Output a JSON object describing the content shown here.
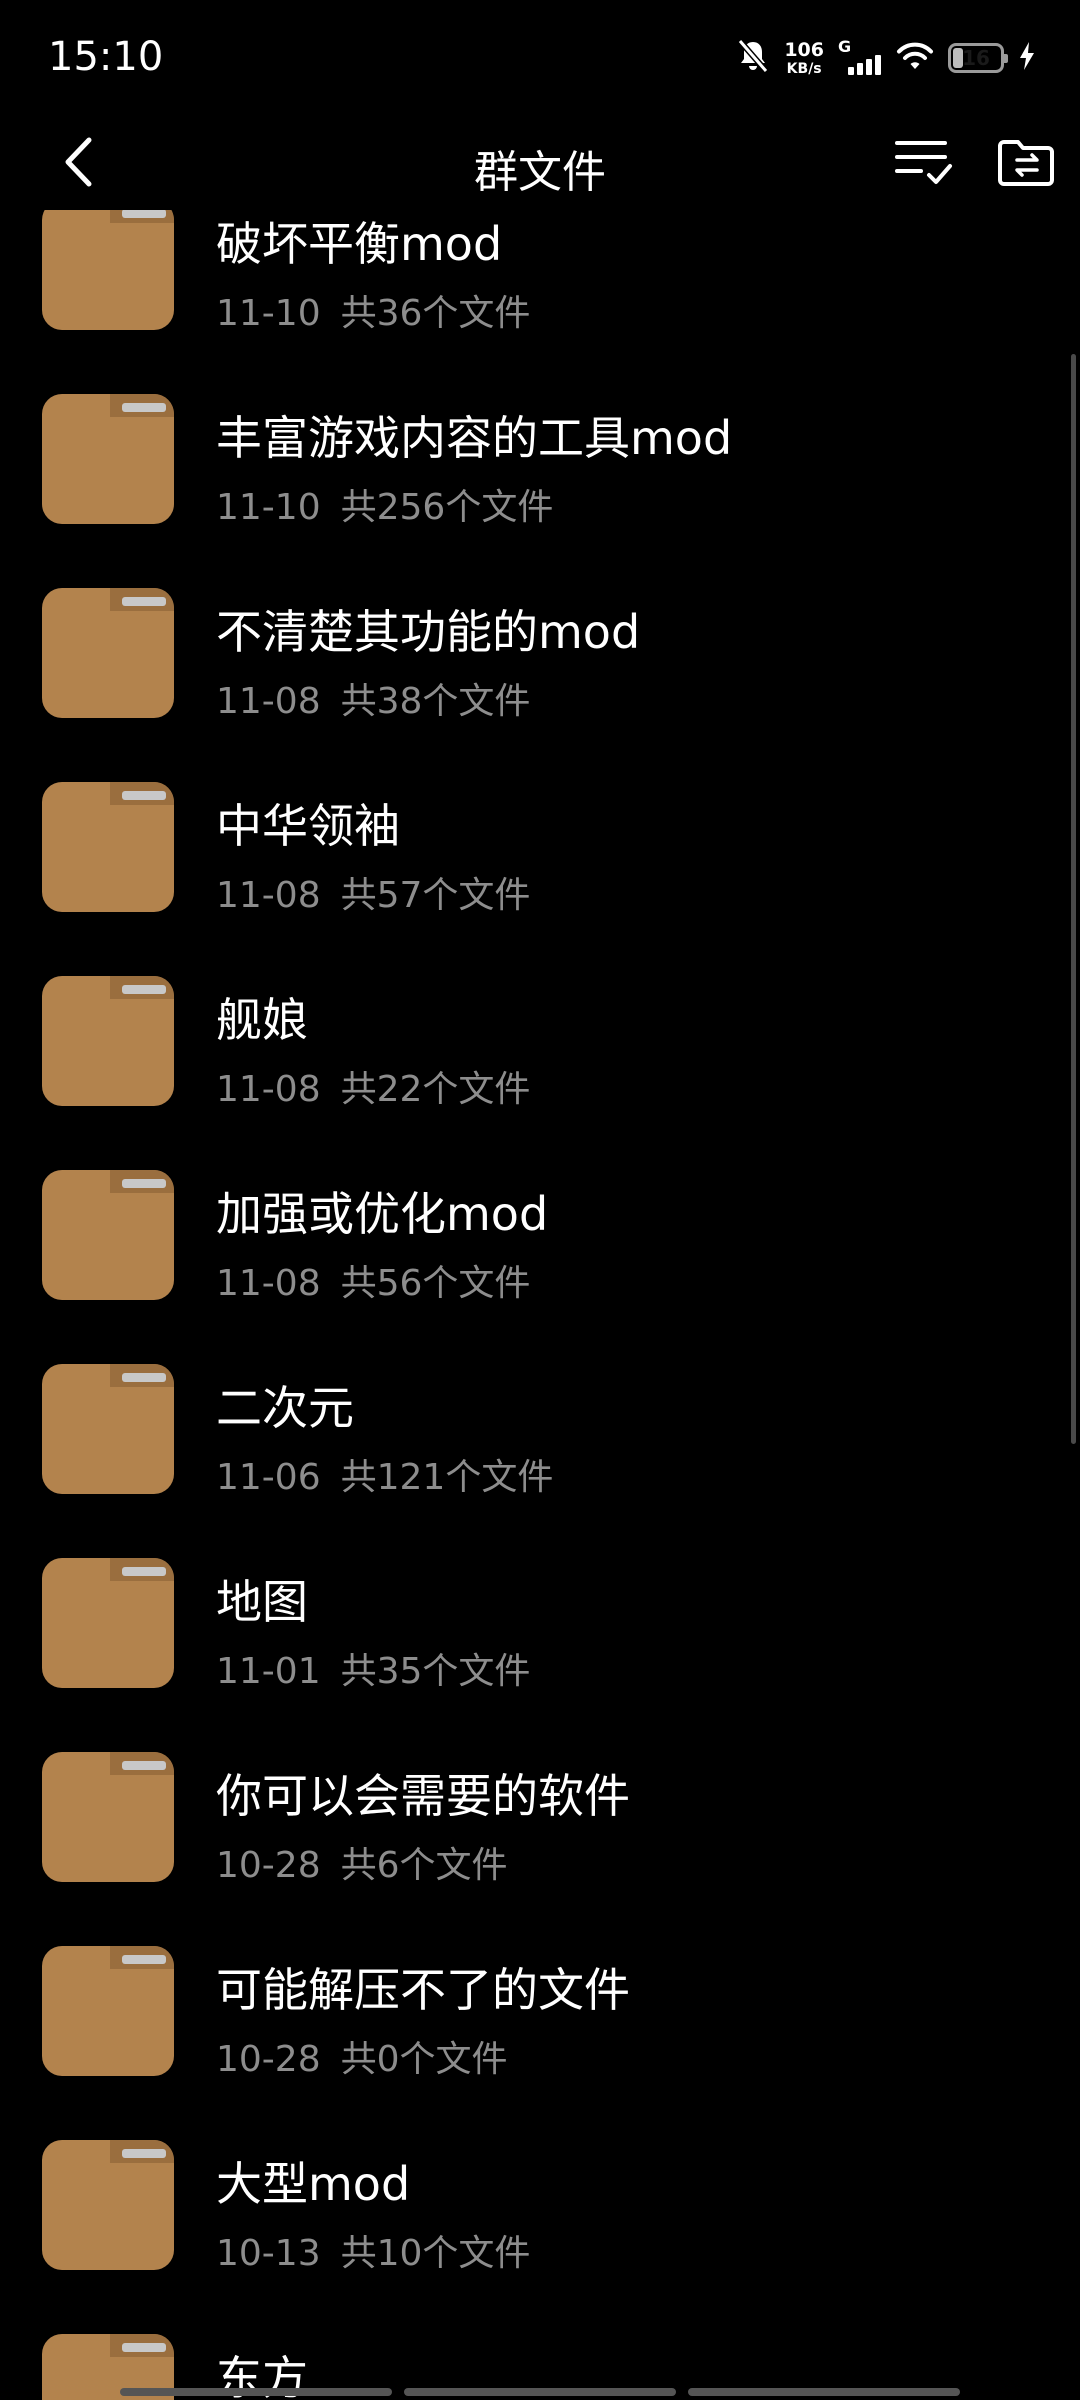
{
  "status_bar": {
    "time": "15:10",
    "net_speed_value": "106",
    "net_speed_unit": "KB/s",
    "signal_label": "G",
    "battery_level": "16",
    "icons": [
      "bell-off-icon",
      "signal-icon",
      "wifi-icon",
      "battery-icon",
      "charging-icon"
    ]
  },
  "header": {
    "title": "群文件",
    "back_icon": "chevron-left-icon",
    "sort_icon": "list-check-icon",
    "folder_action_icon": "folder-transfer-icon"
  },
  "colors": {
    "background": "#000000",
    "folder": "#B3834D",
    "folder_tab": "#C8C8C8",
    "meta_text": "#8D8D8D"
  },
  "folders": [
    {
      "name": "破坏平衡mod",
      "date": "11-10",
      "count": "共36个文件"
    },
    {
      "name": "丰富游戏内容的工具mod",
      "date": "11-10",
      "count": "共256个文件"
    },
    {
      "name": "不清楚其功能的mod",
      "date": "11-08",
      "count": "共38个文件"
    },
    {
      "name": "中华领袖",
      "date": "11-08",
      "count": "共57个文件"
    },
    {
      "name": "舰娘",
      "date": "11-08",
      "count": "共22个文件"
    },
    {
      "name": "加强或优化mod",
      "date": "11-08",
      "count": "共56个文件"
    },
    {
      "name": "二次元",
      "date": "11-06",
      "count": "共121个文件"
    },
    {
      "name": "地图",
      "date": "11-01",
      "count": "共35个文件"
    },
    {
      "name": "你可以会需要的软件",
      "date": "10-28",
      "count": "共6个文件"
    },
    {
      "name": "可能解压不了的文件",
      "date": "10-28",
      "count": "共0个文件"
    },
    {
      "name": "大型mod",
      "date": "10-13",
      "count": "共10个文件"
    },
    {
      "name": "东方",
      "date": "",
      "count": ""
    }
  ]
}
